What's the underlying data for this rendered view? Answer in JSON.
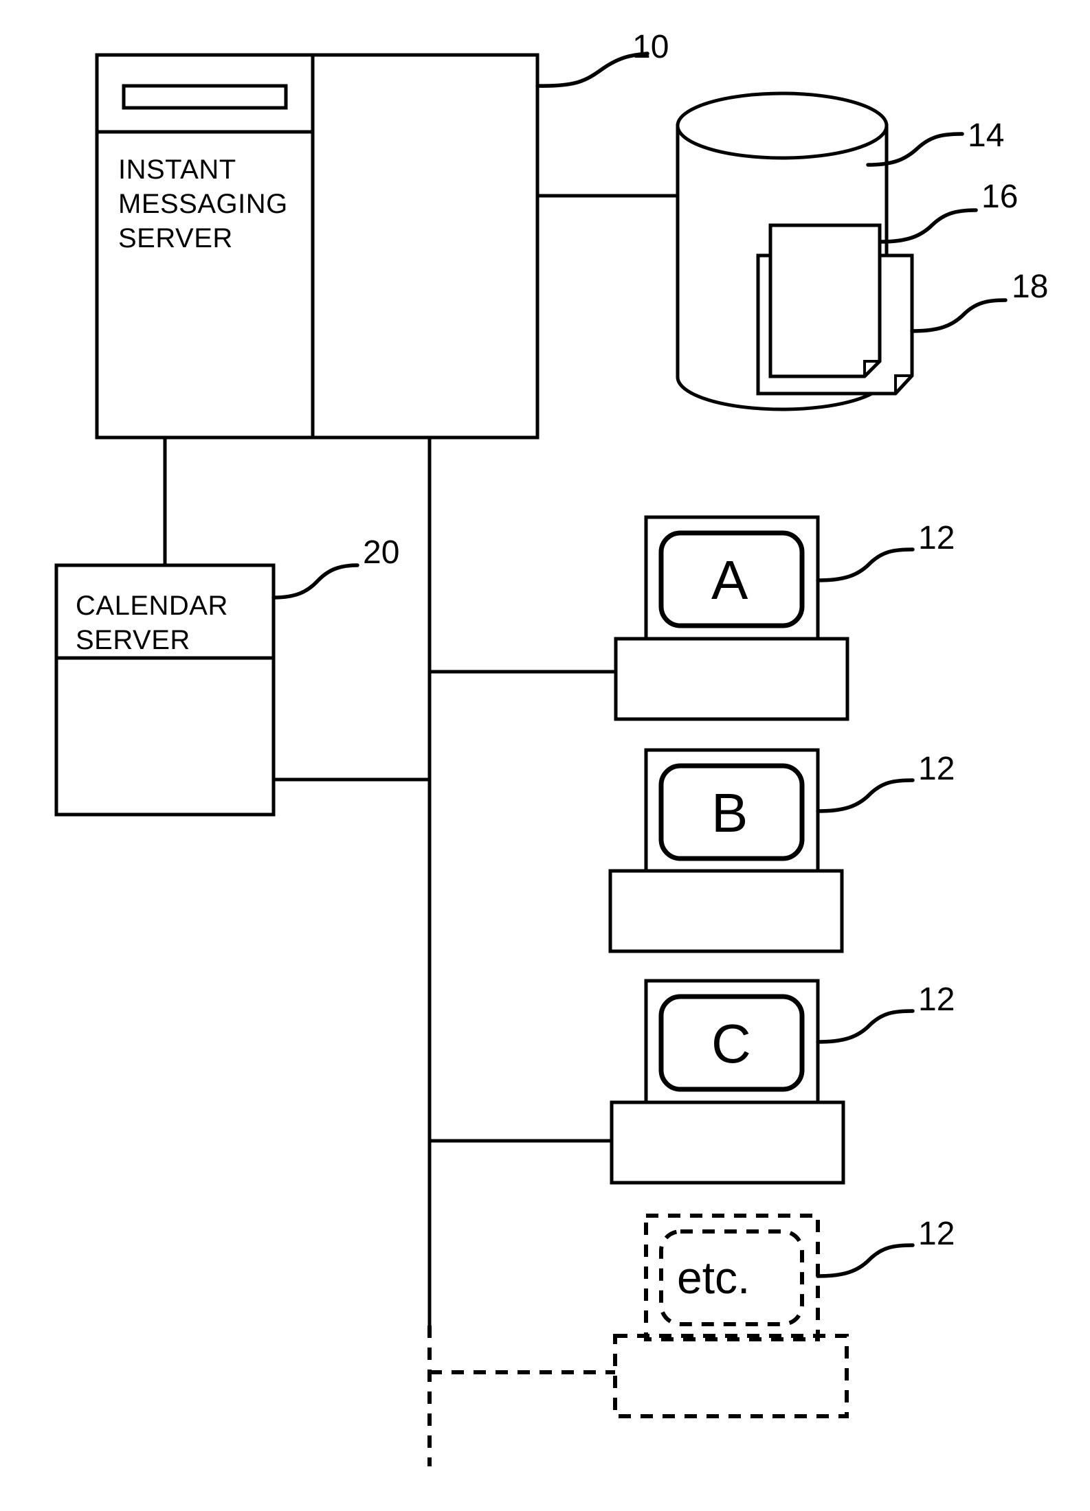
{
  "figure": {
    "kind": "patent-system-block-diagram",
    "background_color": "#ffffff",
    "line_color": "#000000"
  },
  "nodes": {
    "instant_messaging_server": {
      "label_line1": "INSTANT",
      "label_line2": "MESSAGING",
      "label_line3": "SERVER",
      "ref": "10"
    },
    "calendar_server": {
      "label_line1": "CALENDAR",
      "label_line2": "SERVER",
      "ref": "20"
    },
    "database": {
      "ref": "14"
    },
    "document_front": {
      "ref": "16"
    },
    "document_back": {
      "ref": "18"
    },
    "terminal_a": {
      "screen_label": "A",
      "ref": "12"
    },
    "terminal_b": {
      "screen_label": "B",
      "ref": "12"
    },
    "terminal_c": {
      "screen_label": "C",
      "ref": "12"
    },
    "terminal_etc": {
      "screen_label": "etc.",
      "ref": "12"
    }
  },
  "reference_numerals": [
    {
      "id": "ref-10",
      "text": "10"
    },
    {
      "id": "ref-14",
      "text": "14"
    },
    {
      "id": "ref-16",
      "text": "16"
    },
    {
      "id": "ref-18",
      "text": "18"
    },
    {
      "id": "ref-20",
      "text": "20"
    },
    {
      "id": "ref-12-a",
      "text": "12"
    },
    {
      "id": "ref-12-b",
      "text": "12"
    },
    {
      "id": "ref-12-c",
      "text": "12"
    },
    {
      "id": "ref-12-etc",
      "text": "12"
    }
  ]
}
